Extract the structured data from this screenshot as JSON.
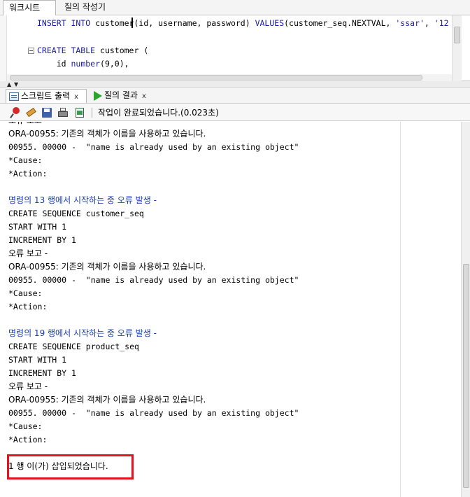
{
  "top_tabs": {
    "worksheet": "워크시트",
    "query_builder": "질의 작성기"
  },
  "editor": {
    "line1": {
      "insert": "INSERT INTO",
      "rest1": " customer(id, username, password) ",
      "values": "VALUES",
      "rest2": "(customer_seq.NEXTVAL, ",
      "str1": "'ssar'",
      "rest3": ", ",
      "str2": "'12"
    },
    "line2": {
      "create": "CREATE TABLE",
      "rest": " customer ("
    },
    "line3": {
      "ident": "    id ",
      "type": "number",
      "rest": "(9,0),"
    }
  },
  "bottom_tabs": {
    "script_output": "스크립트 출력",
    "query_result": "질의 결과",
    "close": "x"
  },
  "toolbar": {
    "status": "작업이 완료되었습니다.(0.023초)"
  },
  "output": {
    "lines": [
      "오류 보고 -",
      "ORA-00955: 기존의 객체가 이름을 사용하고 있습니다.",
      "00955. 00000 -  \"name is already used by an existing object\"",
      "*Cause:",
      "*Action:",
      "",
      "명령의 13 행에서 시작하는 중 오류 발생 -",
      "CREATE SEQUENCE customer_seq",
      "START WITH 1",
      "INCREMENT BY 1",
      "오류 보고 -",
      "ORA-00955: 기존의 객체가 이름을 사용하고 있습니다.",
      "00955. 00000 -  \"name is already used by an existing object\"",
      "*Cause:",
      "*Action:",
      "",
      "명령의 19 행에서 시작하는 중 오류 발생 -",
      "CREATE SEQUENCE product_seq",
      "START WITH 1",
      "INCREMENT BY 1",
      "오류 보고 -",
      "ORA-00955: 기존의 객체가 이름을 사용하고 있습니다.",
      "00955. 00000 -  \"name is already used by an existing object\"",
      "*Cause:",
      "*Action:",
      "",
      "1 행 이(가) 삽입되었습니다."
    ]
  },
  "colors": {
    "keyword": "#1a1aa6",
    "error_header": "#1a3cb0",
    "highlight": "#e0141e"
  }
}
